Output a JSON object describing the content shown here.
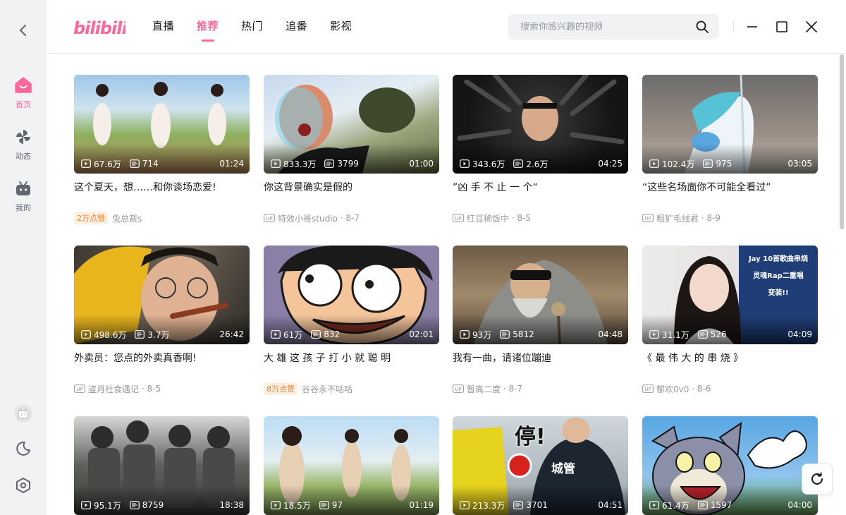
{
  "app": {
    "logo_text": "bilibili",
    "accent": "#ff6699"
  },
  "sidebar": {
    "items": [
      {
        "label": "首页",
        "icon": "home-icon",
        "active": true
      },
      {
        "label": "动态",
        "icon": "pinwheel-icon",
        "active": false
      },
      {
        "label": "我的",
        "icon": "tv-icon",
        "active": false
      }
    ],
    "bottom_icons": [
      "avatar-icon",
      "moon-icon",
      "settings-icon"
    ]
  },
  "header": {
    "nav": [
      {
        "label": "直播",
        "active": false
      },
      {
        "label": "推荐",
        "active": true
      },
      {
        "label": "热门",
        "active": false
      },
      {
        "label": "追番",
        "active": false
      },
      {
        "label": "影视",
        "active": false
      }
    ],
    "search_placeholder": "搜索你感兴趣的视频"
  },
  "videos": [
    {
      "title": "这个夏天，想……和你谈场恋爱!",
      "views": "67.6万",
      "danmaku": "714",
      "duration": "01:24",
      "badge": "2万点赞",
      "author": "兔总裁s",
      "date": ""
    },
    {
      "title": "你这背景确实是假的",
      "views": "833.3万",
      "danmaku": "3799",
      "duration": "01:00",
      "badge": "",
      "author": "特效小哥studio",
      "date": "8-7"
    },
    {
      "title": "”凶 手 不 止 一 个“",
      "views": "343.6万",
      "danmaku": "2.6万",
      "duration": "04:25",
      "badge": "",
      "author": "红豆稀饭中",
      "date": "8-5"
    },
    {
      "title": "“这些名场面你不可能全看过”",
      "views": "102.4万",
      "danmaku": "975",
      "duration": "03:05",
      "badge": "",
      "author": "粗犷毛线君",
      "date": "8-9"
    },
    {
      "title": "外卖员：您点的外卖真香啊!",
      "views": "498.6万",
      "danmaku": "3.7万",
      "duration": "26:42",
      "badge": "",
      "author": "盗月社食遇记",
      "date": "8-5"
    },
    {
      "title": "大 雄 这 孩 子 打 小 就 聪 明",
      "views": "61万",
      "danmaku": "832",
      "duration": "02:01",
      "badge": "8万点赞",
      "author": "谷谷永不咕咕",
      "date": ""
    },
    {
      "title": "我有一曲，请诸位蹦迪",
      "views": "93万",
      "danmaku": "5812",
      "duration": "04:48",
      "badge": "",
      "author": "暂离二度",
      "date": "8-7"
    },
    {
      "title": "《 最 伟 大 的 串 烧 》",
      "views": "31.1万",
      "danmaku": "526",
      "duration": "04:09",
      "badge": "",
      "author": "郁欢0v0",
      "date": "8-6"
    },
    {
      "title": "",
      "views": "95.1万",
      "danmaku": "8759",
      "duration": "18:38",
      "badge": "",
      "author": "",
      "date": ""
    },
    {
      "title": "",
      "views": "18.5万",
      "danmaku": "97",
      "duration": "01:19",
      "badge": "",
      "author": "",
      "date": ""
    },
    {
      "title": "",
      "views": "213.3万",
      "danmaku": "3701",
      "duration": "04:51",
      "badge": "",
      "author": "",
      "date": ""
    },
    {
      "title": "",
      "views": "61.4万",
      "danmaku": "1597",
      "duration": "04:00",
      "badge": "",
      "author": "",
      "date": ""
    }
  ],
  "thumb_overlay_texts": {
    "video_8": [
      "Jay 10首歌曲串烧",
      "灵魂Rap二重唱",
      "变装!!"
    ],
    "video_11": [
      "停!",
      "城管"
    ]
  }
}
